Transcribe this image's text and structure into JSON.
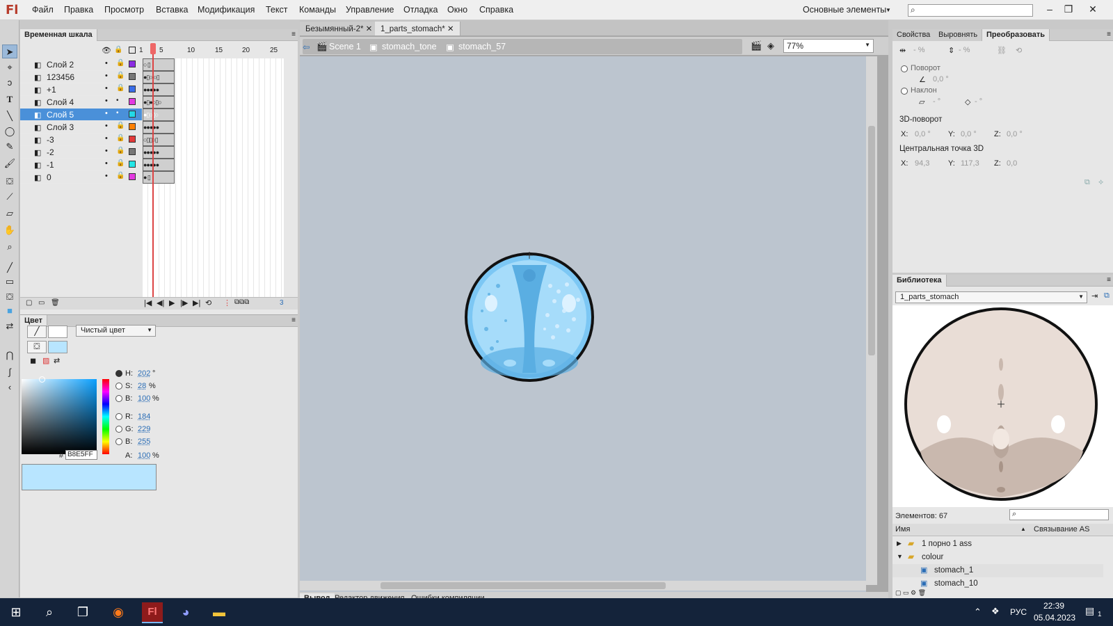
{
  "app": {
    "logo": "Fl"
  },
  "menu": [
    "Файл",
    "Правка",
    "Просмотр",
    "Вставка",
    "Модификация",
    "Текст",
    "Команды",
    "Управление",
    "Отладка",
    "Окно",
    "Справка"
  ],
  "workspace": "Основные элементы",
  "timeline": {
    "tab": "Временная шкала",
    "ruler": [
      "1",
      "5",
      "10",
      "15",
      "20",
      "25"
    ],
    "layers": [
      {
        "name": "Слой 2",
        "color": "#8a2be2",
        "frames": "○ ▯"
      },
      {
        "name": "123456",
        "color": "#777777",
        "frames": "●▯○ ○▯"
      },
      {
        "name": "+1",
        "color": "#3a6de8",
        "frames": "●●●●●"
      },
      {
        "name": "Слой 4",
        "color": "#e33ae0",
        "frames": "●▯●○▯○"
      },
      {
        "name": "Слой 5",
        "color": "#23d8e6",
        "frames": "●▯○▯○"
      },
      {
        "name": "Слой 3",
        "color": "#ff7f00",
        "frames": "●●●●●"
      },
      {
        "name": "-3",
        "color": "#e33a3a",
        "frames": "○▯▯○▯"
      },
      {
        "name": "-2",
        "color": "#777777",
        "frames": "●●●●●"
      },
      {
        "name": "-1",
        "color": "#23e6e6",
        "frames": "●●●●●"
      },
      {
        "name": "0",
        "color": "#e33ae0",
        "frames": "● ▯"
      }
    ],
    "controls": "◀ ▶ ▶| ⟲",
    "frame_count": "3"
  },
  "color_panel": {
    "tab": "Цвет",
    "fill_type": "Чистый цвет",
    "H": "202",
    "S": "28",
    "Bv": "100",
    "R": "184",
    "G": "229",
    "B": "255",
    "hex": "B8E5FF",
    "A": "100",
    "deg": "°",
    "pct": "%",
    "hash": "#",
    "labels": {
      "H": "H:",
      "S": "S:",
      "Bv": "B:",
      "R": "R:",
      "G": "G:",
      "B": "B:",
      "A": "A:"
    },
    "swatch": "#b8e5ff"
  },
  "doc_tabs": [
    "Безымянный-2*",
    "1_parts_stomach*"
  ],
  "breadcrumbs": [
    "Scene 1",
    "stomach_tone",
    "stomach_57"
  ],
  "zoom": "77%",
  "output_tabs": [
    "Вывод",
    "Редактор движения",
    "Ошибки компиляции"
  ],
  "props": {
    "tabs": [
      "Свойства",
      "Выровнять",
      "Преобразовать"
    ],
    "scale_w": "- %",
    "scale_h": "- %",
    "rotate_label": "Поворот",
    "rotate_val": "0,0 °",
    "skew_label": "Наклон",
    "skew_h": "- °",
    "skew_v": "- °",
    "rot3d_label": "3D-поворот",
    "rot3d": {
      "x": "0,0 °",
      "y": "0,0 °",
      "z": "0,0 °"
    },
    "center3d_label": "Центральная точка 3D",
    "center3d": {
      "x": "94,3",
      "y": "117,3",
      "z": "0,0"
    },
    "axes": {
      "x": "X:",
      "y": "Y:",
      "z": "Z:"
    }
  },
  "library": {
    "tab": "Библиотека",
    "doc": "1_parts_stomach",
    "count": "Элементов: 67",
    "col_name": "Имя",
    "col_link": "Связывание AS",
    "items": [
      {
        "name": "1 порно 1 ass",
        "type": "folder"
      },
      {
        "name": "colour",
        "type": "folder-open"
      },
      {
        "name": "stomach_1",
        "type": "symbol"
      },
      {
        "name": "stomach_10",
        "type": "symbol"
      }
    ]
  },
  "taskbar": {
    "lang": "РУС",
    "time": "22:39",
    "date": "05.04.2023",
    "notif": "1"
  },
  "colors": {
    "accent": "#4a90d9",
    "stage": "#bcc5cf",
    "stomach": "#7cc7f4"
  }
}
